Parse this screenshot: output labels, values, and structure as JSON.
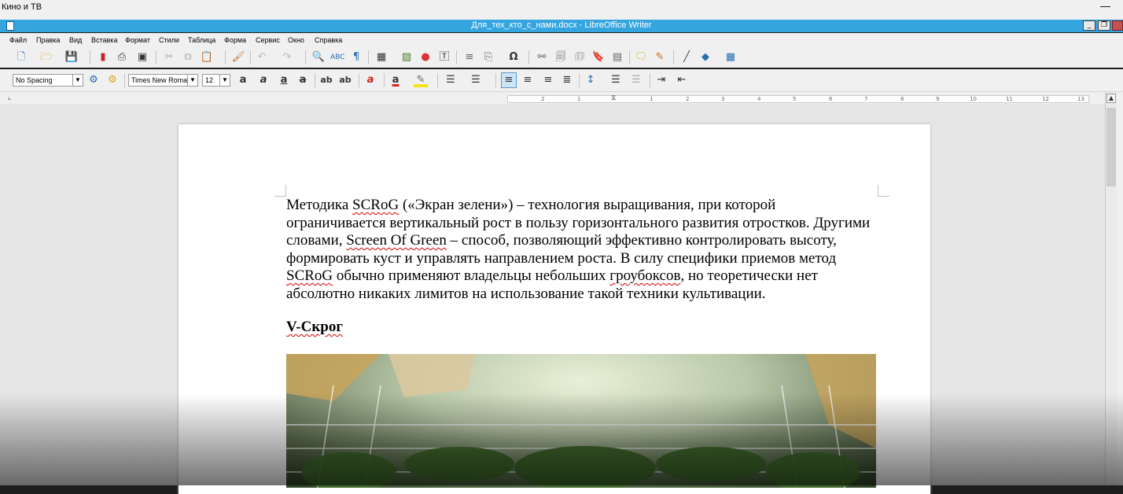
{
  "outer_window": {
    "title": "Кино и ТВ",
    "minimize_glyph": "—"
  },
  "titlebar": {
    "title": "Для_тех_кто_с_нами.docx - LibreOffice Writer"
  },
  "menu": [
    "Файл",
    "Правка",
    "Вид",
    "Вставка",
    "Формат",
    "Стили",
    "Таблица",
    "Форма",
    "Сервис",
    "Окно",
    "Справка"
  ],
  "format_bar": {
    "paragraph_style": "No Spacing",
    "font_name": "Times New Roman",
    "font_size": "12"
  },
  "ruler": {
    "ticks": [
      "2",
      "1",
      "1",
      "2",
      "3",
      "4",
      "5",
      "6",
      "7",
      "8",
      "9",
      "10",
      "11",
      "12",
      "13"
    ]
  },
  "document": {
    "p1_a": "Методика ",
    "p1_b": "SCRoG",
    "p1_c": " («Экран зелени») – технология выращивания, при которой ограничивается вертикальный рост в пользу горизонтального развития отростков. Другими словами, ",
    "p1_d": "Screen Of Green",
    "p1_e": " – способ, позволяющий эффективно контролировать высоту, формировать куст и управлять направлением роста. В силу специфики приемов метод ",
    "p1_f": "SCRoG",
    "p1_g": " обычно применяют владельцы небольших ",
    "p1_h": "гроубоксов",
    "p1_i": ", но теоретически нет абсолютно никаких лимитов на использование такой техники культивации.",
    "heading": "V-Скрог"
  }
}
